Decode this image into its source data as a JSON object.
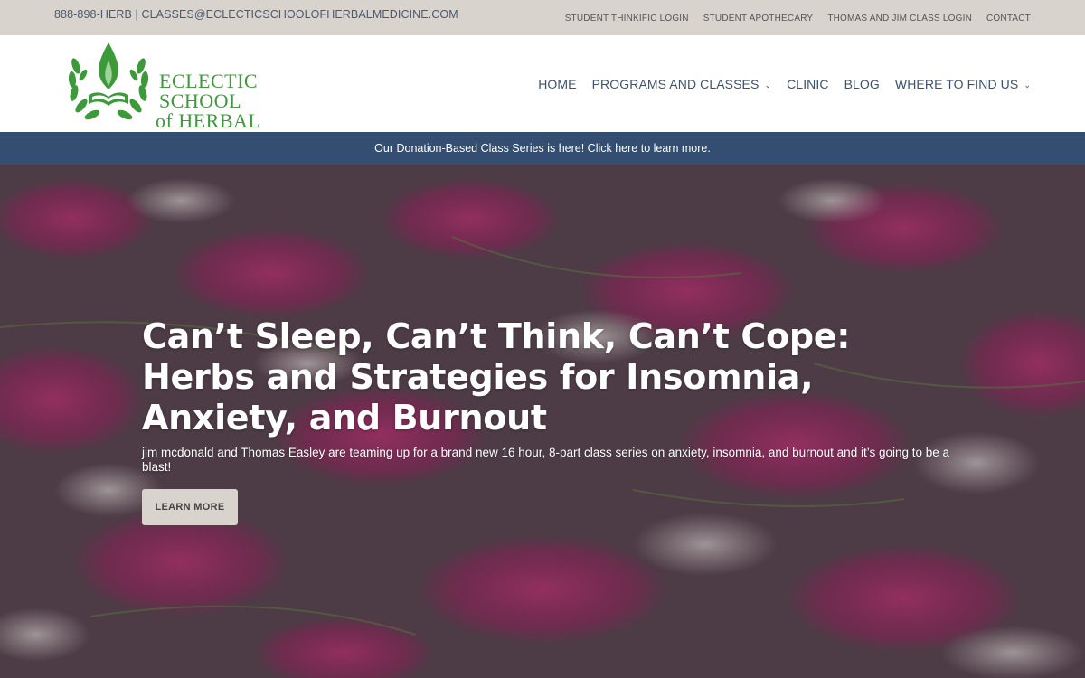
{
  "topbar": {
    "phone": "888-898-HERB",
    "separator": "|",
    "email": "CLASSES@ECLECTICSCHOOLOFHERBALMEDICINE.COM",
    "links": [
      "STUDENT THINKIFIC LOGIN",
      "STUDENT APOTHECARY",
      "THOMAS AND JIM CLASS LOGIN",
      "CONTACT"
    ]
  },
  "logo": {
    "line1": "ECLECTIC SCHOOL",
    "line2": "of HERBAL MEDICINE",
    "brand_color": "#3d9a3a"
  },
  "nav": {
    "items": [
      {
        "label": "HOME",
        "has_dropdown": false
      },
      {
        "label": "PROGRAMS AND CLASSES",
        "has_dropdown": true
      },
      {
        "label": "CLINIC",
        "has_dropdown": false
      },
      {
        "label": "BLOG",
        "has_dropdown": false
      },
      {
        "label": "WHERE TO FIND US",
        "has_dropdown": true
      }
    ],
    "dropdown_icon": "chevron-down-icon"
  },
  "announcement": {
    "text": "Our Donation-Based Class Series is here! Click here to learn more.",
    "bg_color": "#334e70"
  },
  "hero": {
    "title": "Can’t Sleep, Can’t Think, Can’t Cope: Herbs and Strategies for Insomnia, Anxiety, and Burnout",
    "subtitle": "jim mcdonald and Thomas Easley are teaming up for a brand new 16 hour, 8-part class series on anxiety, insomnia, and burnout and it’s going to be a blast!",
    "button_label": "LEARN MORE"
  }
}
